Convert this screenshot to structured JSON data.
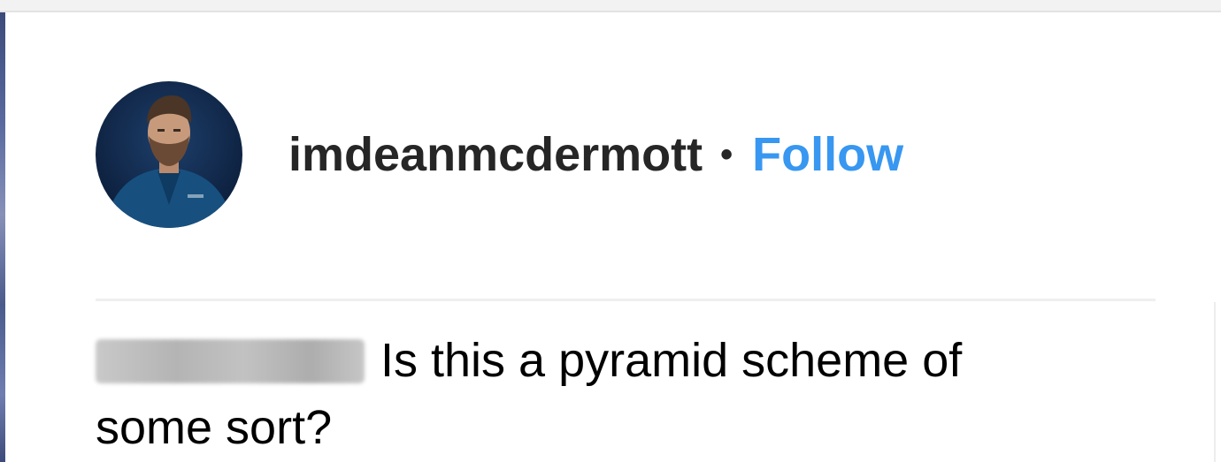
{
  "post_header": {
    "username": "imdeanmcdermott",
    "separator": "•",
    "follow_label": "Follow",
    "avatar_icon": "profile-photo"
  },
  "comment": {
    "author": "",
    "text_line1": "Is this a pyramid scheme of",
    "text_line2": "some sort?"
  },
  "colors": {
    "follow": "#3897f0",
    "username": "#262626",
    "divider": "#efefef"
  }
}
